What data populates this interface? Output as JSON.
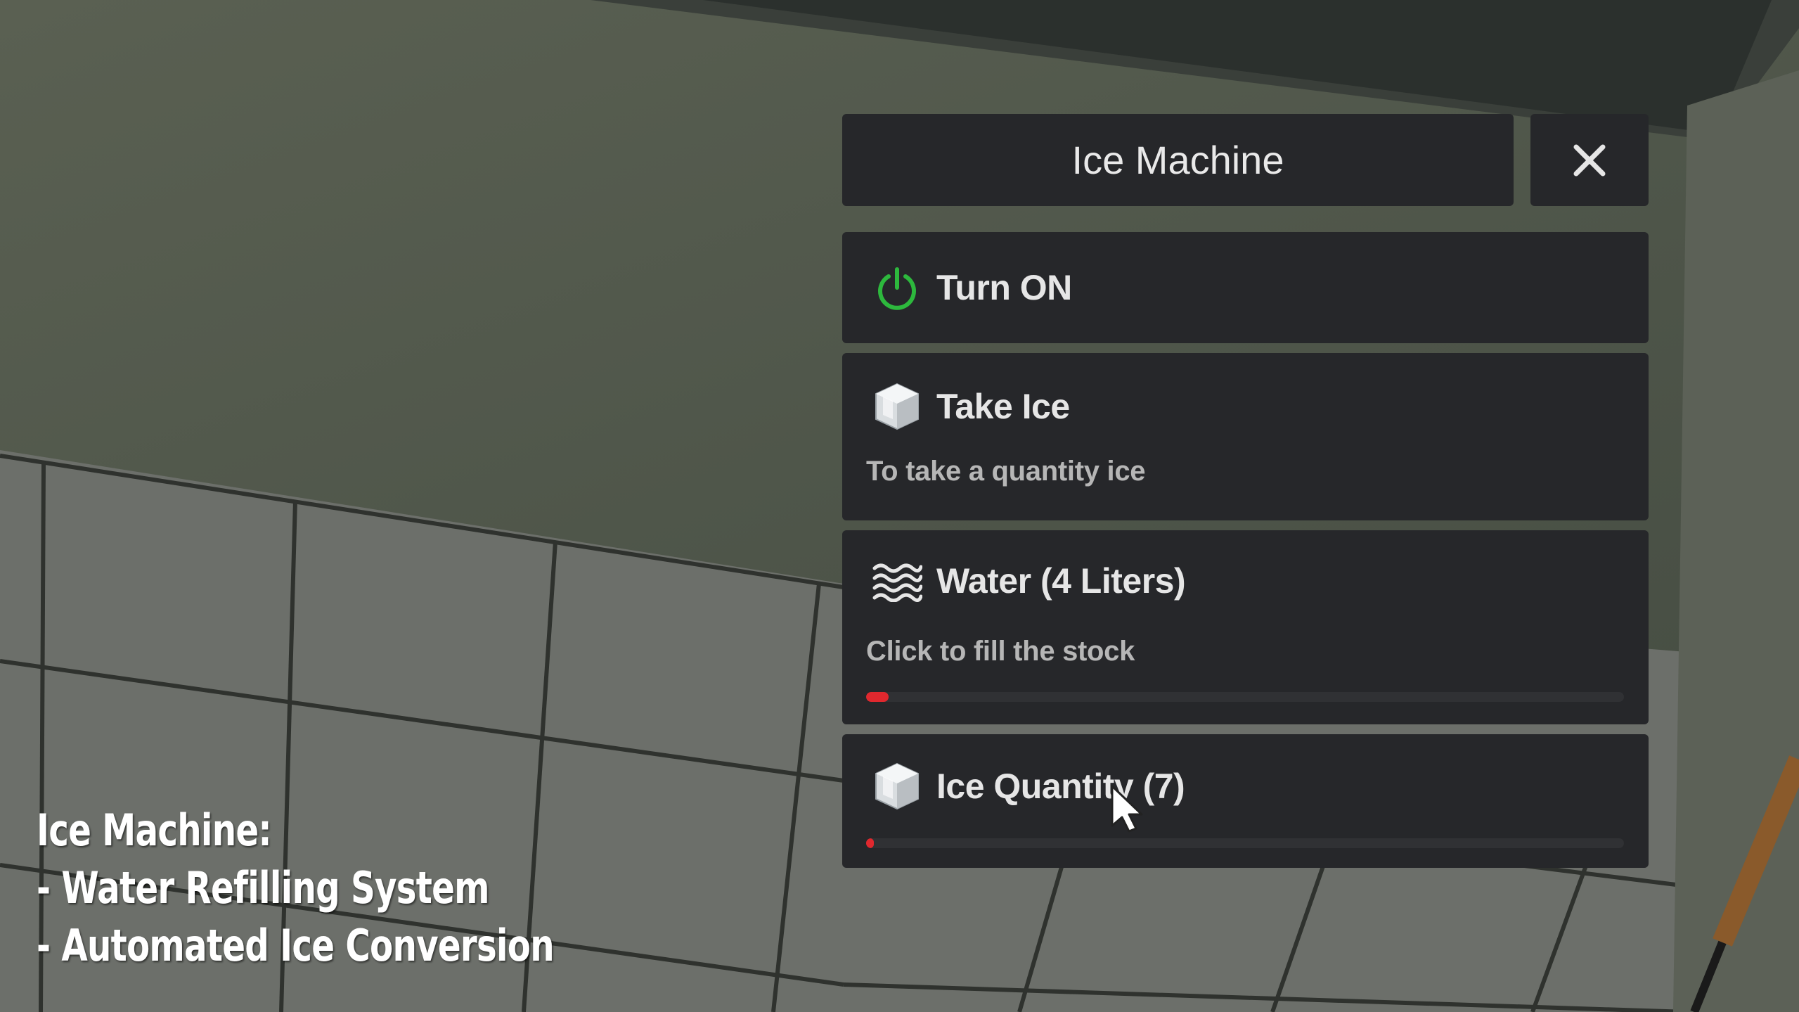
{
  "caption": {
    "line1": "Ice Machine:",
    "line2": "- Water Refilling System",
    "line3": "- Automated Ice Conversion"
  },
  "menu": {
    "title": "Ice Machine",
    "close_icon": "close-icon",
    "items": [
      {
        "icon": "power-icon",
        "icon_color": "#2db83d",
        "label": "Turn ON"
      },
      {
        "icon": "ice-cube-icon",
        "label": "Take Ice",
        "description": "To take a quantity ice"
      },
      {
        "icon": "water-waves-icon",
        "label": "Water (4 Liters)",
        "description": "Click to fill the stock",
        "progress": 0.03,
        "progress_color": "#e0282e"
      },
      {
        "icon": "ice-cube-icon",
        "label": "Ice Quantity (7)",
        "progress": 0.01,
        "progress_color": "#e0282e"
      }
    ]
  }
}
